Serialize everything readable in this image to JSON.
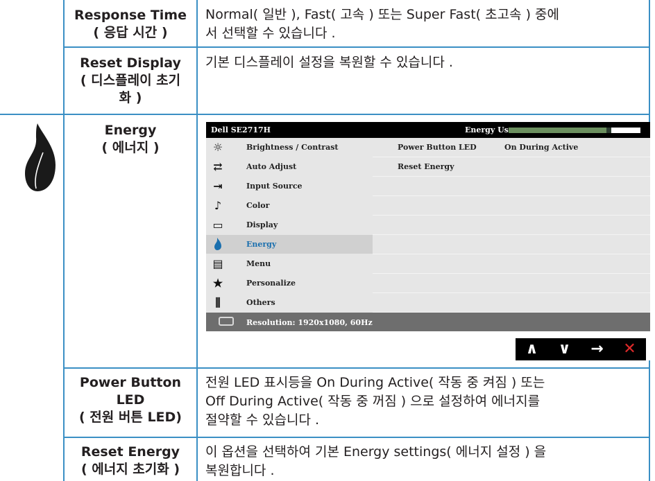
{
  "rows": [
    {
      "name_line1": "Response Time",
      "name_line2": "( 응답 시간 )",
      "name_line3": "",
      "desc_line1": "Normal( 일반 ), Fast( 고속 ) 또는 Super Fast( 초고속 ) 중에",
      "desc_line2": "서 선택할 수 있습니다 .",
      "desc_line3": ""
    },
    {
      "name_line1": "Reset Display",
      "name_line2": "( 디스플레이 초기",
      "name_line3": "화 )",
      "desc_line1": "기본 디스플레이 설정을 복원할 수 있습니다 .",
      "desc_line2": "",
      "desc_line3": ""
    },
    {
      "name_line1": "Energy",
      "name_line2": "( 에너지 )",
      "name_line3": ""
    },
    {
      "name_line1": "Power Button",
      "name_line2": "LED",
      "name_line3": "( 전원 버튼 LED)",
      "desc_line1": "전원 LED 표시등을 On During Active( 작동 중 켜짐 ) 또는",
      "desc_line2": "Off During Active( 작동 중 꺼짐 ) 으로 설정하여 에너지를",
      "desc_line3": "절약할 수 있습니다 ."
    },
    {
      "name_line1": "Reset Energy",
      "name_line2": "( 에너지 초기화 )",
      "name_line3": "",
      "desc_line1": "이 옵션을 선택하여 기본 Energy settings( 에너지 설정 ) 을",
      "desc_line2": "복원합니다 .",
      "desc_line3": ""
    }
  ],
  "osd": {
    "model": "Dell SE2717H",
    "energy_use_label": "Energy Use",
    "energy_use_level": 0.74,
    "menu": [
      {
        "label": "Brightness / Contrast",
        "icon": "brightness-icon",
        "glyph": "☼"
      },
      {
        "label": "Auto Adjust",
        "icon": "auto-adjust-icon",
        "glyph": "⇄"
      },
      {
        "label": "Input Source",
        "icon": "input-source-icon",
        "glyph": "⇥"
      },
      {
        "label": "Color",
        "icon": "color-icon",
        "glyph": "♪"
      },
      {
        "label": "Display",
        "icon": "display-icon",
        "glyph": "▭"
      },
      {
        "label": "Energy",
        "icon": "energy-leaf-icon",
        "glyph": ""
      },
      {
        "label": "Menu",
        "icon": "menu-icon",
        "glyph": "▤"
      },
      {
        "label": "Personalize",
        "icon": "star-icon",
        "glyph": "★"
      },
      {
        "label": "Others",
        "icon": "others-icon",
        "glyph": "⫼"
      }
    ],
    "active_item": "Energy",
    "settings": [
      {
        "label": "Power Button LED",
        "value": "On During Active"
      },
      {
        "label": "Reset Energy",
        "value": ""
      }
    ],
    "status": "Resolution: 1920x1080, 60Hz",
    "nav": [
      "∧",
      "∨",
      "→",
      "✕"
    ]
  },
  "colors": {
    "table_line": "#3a8fc4",
    "osd_active_text": "#1a6fae",
    "close": "#e02a2a",
    "energy_fill": "#6b8f5e"
  }
}
